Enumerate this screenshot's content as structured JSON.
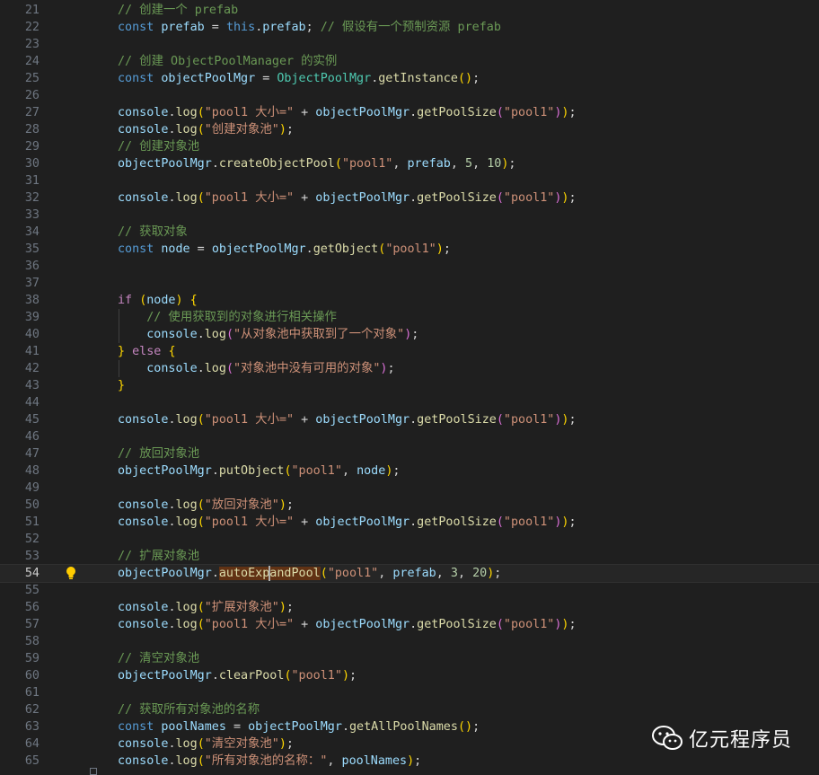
{
  "editor": {
    "active_line": 54,
    "lines": [
      {
        "n": "21",
        "t": [
          [
            "cm",
            "// 创建一个 prefab"
          ]
        ]
      },
      {
        "n": "22",
        "t": [
          [
            "kw",
            "const"
          ],
          [
            "txt",
            " "
          ],
          [
            "var",
            "prefab"
          ],
          [
            "txt",
            " = "
          ],
          [
            "kw",
            "this"
          ],
          [
            "txt",
            "."
          ],
          [
            "var",
            "prefab"
          ],
          [
            "txt",
            "; "
          ],
          [
            "cm",
            "// 假设有一个预制资源 prefab"
          ]
        ]
      },
      {
        "n": "23",
        "t": []
      },
      {
        "n": "24",
        "t": [
          [
            "cm",
            "// 创建 ObjectPoolManager 的实例"
          ]
        ]
      },
      {
        "n": "25",
        "t": [
          [
            "kw",
            "const"
          ],
          [
            "txt",
            " "
          ],
          [
            "var",
            "objectPoolMgr"
          ],
          [
            "txt",
            " = "
          ],
          [
            "cls",
            "ObjectPoolMgr"
          ],
          [
            "txt",
            "."
          ],
          [
            "fn",
            "getInstance"
          ],
          [
            "p1",
            "()"
          ],
          [
            "txt",
            ";"
          ]
        ]
      },
      {
        "n": "26",
        "t": []
      },
      {
        "n": "27",
        "t": [
          [
            "var",
            "console"
          ],
          [
            "txt",
            "."
          ],
          [
            "fn",
            "log"
          ],
          [
            "p1",
            "("
          ],
          [
            "str",
            "\"pool1 大小=\""
          ],
          [
            "txt",
            " + "
          ],
          [
            "var",
            "objectPoolMgr"
          ],
          [
            "txt",
            "."
          ],
          [
            "fn",
            "getPoolSize"
          ],
          [
            "p2",
            "("
          ],
          [
            "str",
            "\"pool1\""
          ],
          [
            "p2",
            ")"
          ],
          [
            "p1",
            ")"
          ],
          [
            "txt",
            ";"
          ]
        ]
      },
      {
        "n": "28",
        "t": [
          [
            "var",
            "console"
          ],
          [
            "txt",
            "."
          ],
          [
            "fn",
            "log"
          ],
          [
            "p1",
            "("
          ],
          [
            "str",
            "\"创建对象池\""
          ],
          [
            "p1",
            ")"
          ],
          [
            "txt",
            ";"
          ]
        ]
      },
      {
        "n": "29",
        "t": [
          [
            "cm",
            "// 创建对象池"
          ]
        ]
      },
      {
        "n": "30",
        "t": [
          [
            "var",
            "objectPoolMgr"
          ],
          [
            "txt",
            "."
          ],
          [
            "fn",
            "createObjectPool"
          ],
          [
            "p1",
            "("
          ],
          [
            "str",
            "\"pool1\""
          ],
          [
            "txt",
            ", "
          ],
          [
            "var",
            "prefab"
          ],
          [
            "txt",
            ", "
          ],
          [
            "num",
            "5"
          ],
          [
            "txt",
            ", "
          ],
          [
            "num",
            "10"
          ],
          [
            "p1",
            ")"
          ],
          [
            "txt",
            ";"
          ]
        ]
      },
      {
        "n": "31",
        "t": []
      },
      {
        "n": "32",
        "t": [
          [
            "var",
            "console"
          ],
          [
            "txt",
            "."
          ],
          [
            "fn",
            "log"
          ],
          [
            "p1",
            "("
          ],
          [
            "str",
            "\"pool1 大小=\""
          ],
          [
            "txt",
            " + "
          ],
          [
            "var",
            "objectPoolMgr"
          ],
          [
            "txt",
            "."
          ],
          [
            "fn",
            "getPoolSize"
          ],
          [
            "p2",
            "("
          ],
          [
            "str",
            "\"pool1\""
          ],
          [
            "p2",
            ")"
          ],
          [
            "p1",
            ")"
          ],
          [
            "txt",
            ";"
          ]
        ]
      },
      {
        "n": "33",
        "t": []
      },
      {
        "n": "34",
        "t": [
          [
            "cm",
            "// 获取对象"
          ]
        ]
      },
      {
        "n": "35",
        "t": [
          [
            "kw",
            "const"
          ],
          [
            "txt",
            " "
          ],
          [
            "var",
            "node"
          ],
          [
            "txt",
            " = "
          ],
          [
            "var",
            "objectPoolMgr"
          ],
          [
            "txt",
            "."
          ],
          [
            "fn",
            "getObject"
          ],
          [
            "p1",
            "("
          ],
          [
            "str",
            "\"pool1\""
          ],
          [
            "p1",
            ")"
          ],
          [
            "txt",
            ";"
          ]
        ]
      },
      {
        "n": "36",
        "t": []
      },
      {
        "n": "37",
        "t": []
      },
      {
        "n": "38",
        "t": [
          [
            "ctl",
            "if"
          ],
          [
            "txt",
            " "
          ],
          [
            "p1",
            "("
          ],
          [
            "var",
            "node"
          ],
          [
            "p1",
            ")"
          ],
          [
            "txt",
            " "
          ],
          [
            "p1",
            "{"
          ]
        ]
      },
      {
        "n": "39",
        "t": [
          [
            "txt",
            "    "
          ],
          [
            "cm",
            "// 使用获取到的对象进行相关操作"
          ]
        ],
        "g": 1
      },
      {
        "n": "40",
        "t": [
          [
            "txt",
            "    "
          ],
          [
            "var",
            "console"
          ],
          [
            "txt",
            "."
          ],
          [
            "fn",
            "log"
          ],
          [
            "p2",
            "("
          ],
          [
            "str",
            "\"从对象池中获取到了一个对象\""
          ],
          [
            "p2",
            ")"
          ],
          [
            "txt",
            ";"
          ]
        ],
        "g": 1
      },
      {
        "n": "41",
        "t": [
          [
            "p1",
            "}"
          ],
          [
            "txt",
            " "
          ],
          [
            "ctl",
            "else"
          ],
          [
            "txt",
            " "
          ],
          [
            "p1",
            "{"
          ]
        ]
      },
      {
        "n": "42",
        "t": [
          [
            "txt",
            "    "
          ],
          [
            "var",
            "console"
          ],
          [
            "txt",
            "."
          ],
          [
            "fn",
            "log"
          ],
          [
            "p2",
            "("
          ],
          [
            "str",
            "\"对象池中没有可用的对象\""
          ],
          [
            "p2",
            ")"
          ],
          [
            "txt",
            ";"
          ]
        ],
        "g": 1
      },
      {
        "n": "43",
        "t": [
          [
            "p1",
            "}"
          ]
        ]
      },
      {
        "n": "44",
        "t": []
      },
      {
        "n": "45",
        "t": [
          [
            "var",
            "console"
          ],
          [
            "txt",
            "."
          ],
          [
            "fn",
            "log"
          ],
          [
            "p1",
            "("
          ],
          [
            "str",
            "\"pool1 大小=\""
          ],
          [
            "txt",
            " + "
          ],
          [
            "var",
            "objectPoolMgr"
          ],
          [
            "txt",
            "."
          ],
          [
            "fn",
            "getPoolSize"
          ],
          [
            "p2",
            "("
          ],
          [
            "str",
            "\"pool1\""
          ],
          [
            "p2",
            ")"
          ],
          [
            "p1",
            ")"
          ],
          [
            "txt",
            ";"
          ]
        ]
      },
      {
        "n": "46",
        "t": []
      },
      {
        "n": "47",
        "t": [
          [
            "cm",
            "// 放回对象池"
          ]
        ]
      },
      {
        "n": "48",
        "t": [
          [
            "var",
            "objectPoolMgr"
          ],
          [
            "txt",
            "."
          ],
          [
            "fn",
            "putObject"
          ],
          [
            "p1",
            "("
          ],
          [
            "str",
            "\"pool1\""
          ],
          [
            "txt",
            ", "
          ],
          [
            "var",
            "node"
          ],
          [
            "p1",
            ")"
          ],
          [
            "txt",
            ";"
          ]
        ]
      },
      {
        "n": "49",
        "t": []
      },
      {
        "n": "50",
        "t": [
          [
            "var",
            "console"
          ],
          [
            "txt",
            "."
          ],
          [
            "fn",
            "log"
          ],
          [
            "p1",
            "("
          ],
          [
            "str",
            "\"放回对象池\""
          ],
          [
            "p1",
            ")"
          ],
          [
            "txt",
            ";"
          ]
        ]
      },
      {
        "n": "51",
        "t": [
          [
            "var",
            "console"
          ],
          [
            "txt",
            "."
          ],
          [
            "fn",
            "log"
          ],
          [
            "p1",
            "("
          ],
          [
            "str",
            "\"pool1 大小=\""
          ],
          [
            "txt",
            " + "
          ],
          [
            "var",
            "objectPoolMgr"
          ],
          [
            "txt",
            "."
          ],
          [
            "fn",
            "getPoolSize"
          ],
          [
            "p2",
            "("
          ],
          [
            "str",
            "\"pool1\""
          ],
          [
            "p2",
            ")"
          ],
          [
            "p1",
            ")"
          ],
          [
            "txt",
            ";"
          ]
        ]
      },
      {
        "n": "52",
        "t": []
      },
      {
        "n": "53",
        "t": [
          [
            "cm",
            "// 扩展对象池"
          ]
        ]
      },
      {
        "n": "54",
        "t": [
          [
            "var",
            "objectPoolMgr"
          ],
          [
            "txt",
            "."
          ],
          [
            "fn hl",
            "autoExpandPool"
          ],
          [
            "p1",
            "("
          ],
          [
            "str",
            "\"pool1\""
          ],
          [
            "txt",
            ", "
          ],
          [
            "var",
            "prefab"
          ],
          [
            "txt",
            ", "
          ],
          [
            "num",
            "3"
          ],
          [
            "txt",
            ", "
          ],
          [
            "num",
            "20"
          ],
          [
            "p1",
            ")"
          ],
          [
            "txt",
            ";"
          ]
        ]
      },
      {
        "n": "55",
        "t": []
      },
      {
        "n": "56",
        "t": [
          [
            "var",
            "console"
          ],
          [
            "txt",
            "."
          ],
          [
            "fn",
            "log"
          ],
          [
            "p1",
            "("
          ],
          [
            "str",
            "\"扩展对象池\""
          ],
          [
            "p1",
            ")"
          ],
          [
            "txt",
            ";"
          ]
        ]
      },
      {
        "n": "57",
        "t": [
          [
            "var",
            "console"
          ],
          [
            "txt",
            "."
          ],
          [
            "fn",
            "log"
          ],
          [
            "p1",
            "("
          ],
          [
            "str",
            "\"pool1 大小=\""
          ],
          [
            "txt",
            " + "
          ],
          [
            "var",
            "objectPoolMgr"
          ],
          [
            "txt",
            "."
          ],
          [
            "fn",
            "getPoolSize"
          ],
          [
            "p2",
            "("
          ],
          [
            "str",
            "\"pool1\""
          ],
          [
            "p2",
            ")"
          ],
          [
            "p1",
            ")"
          ],
          [
            "txt",
            ";"
          ]
        ]
      },
      {
        "n": "58",
        "t": []
      },
      {
        "n": "59",
        "t": [
          [
            "cm",
            "// 清空对象池"
          ]
        ]
      },
      {
        "n": "60",
        "t": [
          [
            "var",
            "objectPoolMgr"
          ],
          [
            "txt",
            "."
          ],
          [
            "fn",
            "clearPool"
          ],
          [
            "p1",
            "("
          ],
          [
            "str",
            "\"pool1\""
          ],
          [
            "p1",
            ")"
          ],
          [
            "txt",
            ";"
          ]
        ]
      },
      {
        "n": "61",
        "t": []
      },
      {
        "n": "62",
        "t": [
          [
            "cm",
            "// 获取所有对象池的名称"
          ]
        ]
      },
      {
        "n": "63",
        "t": [
          [
            "kw",
            "const"
          ],
          [
            "txt",
            " "
          ],
          [
            "var",
            "poolNames"
          ],
          [
            "txt",
            " = "
          ],
          [
            "var",
            "objectPoolMgr"
          ],
          [
            "txt",
            "."
          ],
          [
            "fn",
            "getAllPoolNames"
          ],
          [
            "p1",
            "()"
          ],
          [
            "txt",
            ";"
          ]
        ]
      },
      {
        "n": "64",
        "t": [
          [
            "var",
            "console"
          ],
          [
            "txt",
            "."
          ],
          [
            "fn",
            "log"
          ],
          [
            "p1",
            "("
          ],
          [
            "str",
            "\"清空对象池\""
          ],
          [
            "p1",
            ")"
          ],
          [
            "txt",
            ";"
          ]
        ]
      },
      {
        "n": "65",
        "t": [
          [
            "var",
            "console"
          ],
          [
            "txt",
            "."
          ],
          [
            "fn",
            "log"
          ],
          [
            "p1",
            "("
          ],
          [
            "str",
            "\"所有对象池的名称：\""
          ],
          [
            "txt",
            ", "
          ],
          [
            "var",
            "poolNames"
          ],
          [
            "p1",
            ")"
          ],
          [
            "txt",
            ";"
          ]
        ]
      }
    ]
  },
  "gutter": {
    "lightbulb_icon": "lightbulb-icon"
  },
  "watermark": {
    "text": "亿元程序员",
    "icon": "wechat-icon"
  }
}
